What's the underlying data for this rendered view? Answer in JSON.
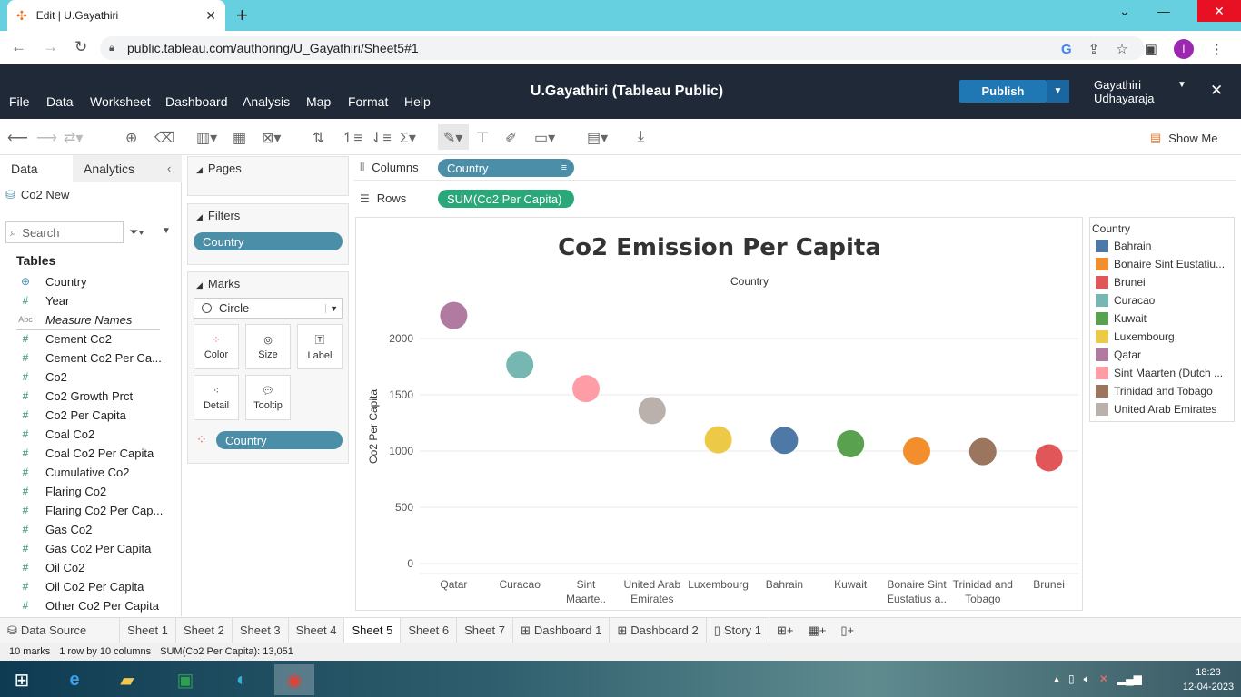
{
  "browser": {
    "tab_title": "Edit | U.Gayathiri",
    "url": "public.tableau.com/authoring/U_Gayathiri/Sheet5#1"
  },
  "app": {
    "menus": [
      "File",
      "Data",
      "Worksheet",
      "Dashboard",
      "Analysis",
      "Map",
      "Format",
      "Help"
    ],
    "title": "U.Gayathiri (Tableau Public)",
    "publish": "Publish",
    "user_line1": "Gayathiri",
    "user_line2": "Udhayaraja",
    "show_me": "Show Me"
  },
  "left": {
    "tab_data": "Data",
    "tab_analytics": "Analytics",
    "datasource": "Co2 New",
    "search_placeholder": "Search",
    "tables_label": "Tables",
    "fields": [
      {
        "icon": "globe-icon",
        "name": "Country"
      },
      {
        "icon": "hash-icon",
        "name": "Year"
      },
      {
        "icon": "abc-icon",
        "name": "Measure Names"
      },
      {
        "icon": "hash-icon",
        "name": "Cement Co2"
      },
      {
        "icon": "hash-icon",
        "name": "Cement Co2 Per Ca..."
      },
      {
        "icon": "hash-icon",
        "name": "Co2"
      },
      {
        "icon": "hash-icon",
        "name": "Co2 Growth Prct"
      },
      {
        "icon": "hash-icon",
        "name": "Co2 Per Capita"
      },
      {
        "icon": "hash-icon",
        "name": "Coal Co2"
      },
      {
        "icon": "hash-icon",
        "name": "Coal Co2 Per Capita"
      },
      {
        "icon": "hash-icon",
        "name": "Cumulative Co2"
      },
      {
        "icon": "hash-icon",
        "name": "Flaring Co2"
      },
      {
        "icon": "hash-icon",
        "name": "Flaring Co2 Per Cap..."
      },
      {
        "icon": "hash-icon",
        "name": "Gas Co2"
      },
      {
        "icon": "hash-icon",
        "name": "Gas Co2 Per Capita"
      },
      {
        "icon": "hash-icon",
        "name": "Oil Co2"
      },
      {
        "icon": "hash-icon",
        "name": "Oil Co2 Per Capita"
      },
      {
        "icon": "hash-icon",
        "name": "Other Co2 Per Capita"
      }
    ]
  },
  "cards": {
    "pages": "Pages",
    "filters": "Filters",
    "filter_pill": "Country",
    "marks": "Marks",
    "mark_type": "Circle",
    "btn_color": "Color",
    "btn_size": "Size",
    "btn_label": "Label",
    "btn_detail": "Detail",
    "btn_tooltip": "Tooltip",
    "color_pill": "Country"
  },
  "shelves": {
    "columns_label": "Columns",
    "columns_pill": "Country",
    "rows_label": "Rows",
    "rows_pill": "SUM(Co2 Per Capita)"
  },
  "chart_data": {
    "type": "scatter",
    "title": "Co2 Emission Per Capita",
    "header": "Country",
    "ylabel": "Co2 Per Capita",
    "ylim": [
      0,
      2400
    ],
    "yticks": [
      0,
      500,
      1000,
      1500,
      2000
    ],
    "categories": [
      "Qatar",
      "Curacao",
      "Sint Maarte..",
      "United Arab Emirates",
      "Luxembourg",
      "Bahrain",
      "Kuwait",
      "Bonaire Sint Eustatius a..",
      "Trinidad and Tobago",
      "Brunei"
    ],
    "values": [
      2205,
      1765,
      1555,
      1360,
      1100,
      1095,
      1065,
      1000,
      995,
      940
    ],
    "colors": [
      "#b07aa1",
      "#76b7b2",
      "#ff9da7",
      "#bab0ac",
      "#edc948",
      "#4e79a7",
      "#59a14f",
      "#f28e2b",
      "#9c755f",
      "#e15759"
    ]
  },
  "legend": {
    "title": "Country",
    "items": [
      {
        "name": "Bahrain",
        "color": "#4e79a7"
      },
      {
        "name": "Bonaire Sint Eustatiu...",
        "color": "#f28e2b"
      },
      {
        "name": "Brunei",
        "color": "#e15759"
      },
      {
        "name": "Curacao",
        "color": "#76b7b2"
      },
      {
        "name": "Kuwait",
        "color": "#59a14f"
      },
      {
        "name": "Luxembourg",
        "color": "#edc948"
      },
      {
        "name": "Qatar",
        "color": "#b07aa1"
      },
      {
        "name": "Sint Maarten (Dutch ...",
        "color": "#ff9da7"
      },
      {
        "name": "Trinidad and Tobago",
        "color": "#9c755f"
      },
      {
        "name": "United Arab Emirates",
        "color": "#bab0ac"
      }
    ]
  },
  "sheet_tabs": [
    "Data Source",
    "Sheet 1",
    "Sheet 2",
    "Sheet 3",
    "Sheet 4",
    "Sheet 5",
    "Sheet 6",
    "Sheet 7",
    "Dashboard 1",
    "Dashboard 2",
    "Story 1"
  ],
  "active_tab": "Sheet 5",
  "status": {
    "marks": "10 marks",
    "dims": "1 row by 10 columns",
    "sum": "SUM(Co2 Per Capita): 13,051"
  },
  "taskbar": {
    "time": "18:23",
    "date": "12-04-2023"
  }
}
